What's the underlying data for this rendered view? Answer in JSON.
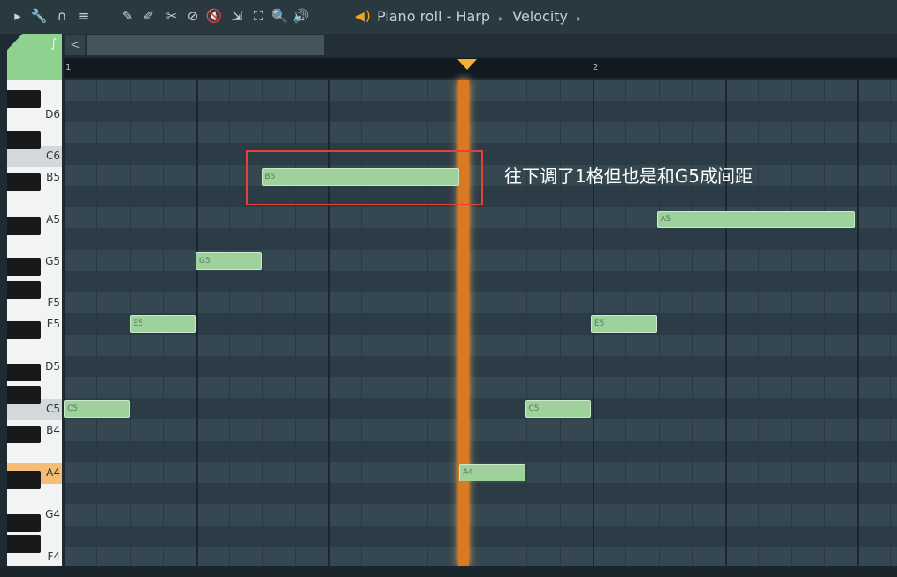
{
  "toolbar": {
    "icons": [
      "play-arrow-icon",
      "wrench-icon",
      "magnet-icon",
      "menu-icon",
      "pencil-icon",
      "paint-icon",
      "slice-icon",
      "mute-icon",
      "speaker-mute-icon",
      "slip-icon",
      "select-icon",
      "zoom-icon",
      "playback-icon"
    ],
    "glyphs": [
      "▸",
      "🔧",
      "∩",
      "≡",
      "✎",
      "✐",
      "✂",
      "⊘",
      "🔇",
      "⇲",
      "⛶",
      "🔍",
      "🔊"
    ],
    "title_icon": "speaker-icon",
    "title_parts": [
      "Piano roll",
      "Harp",
      "Velocity"
    ],
    "title_sep": "-",
    "breadcrumb_sep": "▸"
  },
  "scroll": {
    "left_arrow": "<"
  },
  "ruler": {
    "bars": [
      "1",
      "2"
    ]
  },
  "keyboard": {
    "labels": [
      "D6",
      "C6",
      "B5",
      "A5",
      "G5",
      "F5",
      "E5",
      "D5",
      "C5",
      "B4",
      "A4",
      "G4",
      "F4"
    ],
    "highlighted": "A4"
  },
  "notes": [
    {
      "label": "C5",
      "pitch": "C5",
      "start": 0.0,
      "length": 0.5
    },
    {
      "label": "E5",
      "pitch": "E5",
      "start": 0.5,
      "length": 0.5
    },
    {
      "label": "G5",
      "pitch": "G5",
      "start": 1.0,
      "length": 0.5
    },
    {
      "label": "B5",
      "pitch": "B5",
      "start": 1.5,
      "length": 1.5
    },
    {
      "label": "A4",
      "pitch": "A4",
      "start": 3.0,
      "length": 0.5
    },
    {
      "label": "C5",
      "pitch": "C5",
      "start": 3.5,
      "length": 0.5
    },
    {
      "label": "E5",
      "pitch": "E5",
      "start": 4.0,
      "length": 0.5
    },
    {
      "label": "A5",
      "pitch": "A5",
      "start": 4.5,
      "length": 1.5
    }
  ],
  "annotation": {
    "text": "往下调了1格但也是和G5成间距",
    "color": "#e5403a"
  },
  "colors": {
    "note": "#9fd19d",
    "playhead": "#d97a22",
    "highlight_key": "#f6bd77"
  }
}
